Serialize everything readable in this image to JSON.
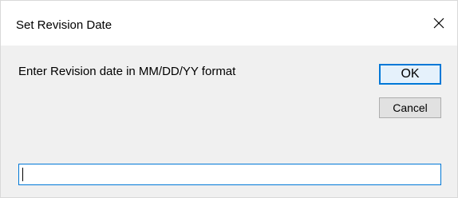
{
  "window": {
    "title": "Set Revision Date"
  },
  "dialog": {
    "prompt": "Enter Revision date in MM/DD/YY format",
    "ok_label": "OK",
    "cancel_label": "Cancel",
    "input_value": ""
  },
  "icons": {
    "close": "close-icon"
  },
  "colors": {
    "focus_accent": "#0078d7",
    "client_background": "#f0f0f0",
    "button_background": "#e1e1e1"
  }
}
